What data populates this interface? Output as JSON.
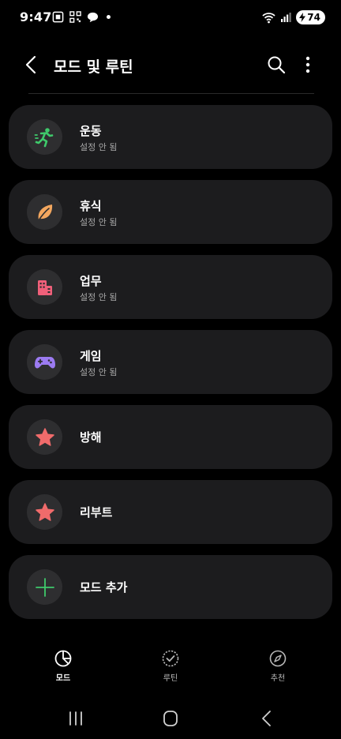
{
  "status_bar": {
    "time": "9:47",
    "battery": "74"
  },
  "header": {
    "title": "모드 및 루틴"
  },
  "modes": [
    {
      "name": "운동",
      "status": "설정 안 됨",
      "icon": "running-person-icon",
      "color": "#3fca6b"
    },
    {
      "name": "휴식",
      "status": "설정 안 됨",
      "icon": "leaf-icon",
      "color": "#f3a75f"
    },
    {
      "name": "업무",
      "status": "설정 안 됨",
      "icon": "building-icon",
      "color": "#f0607a"
    },
    {
      "name": "게임",
      "status": "설정 안 됨",
      "icon": "gamepad-icon",
      "color": "#9c7bf2"
    },
    {
      "name": "방해",
      "icon": "star-icon",
      "color": "#f06b6b"
    },
    {
      "name": "리부트",
      "icon": "star-icon",
      "color": "#f06b6b"
    },
    {
      "name": "모드 추가",
      "icon": "plus-icon",
      "color": "#3fca6b"
    }
  ],
  "bottom_nav": [
    {
      "label": "모드",
      "icon": "pie-chart-icon",
      "active": true
    },
    {
      "label": "루틴",
      "icon": "check-circle-icon",
      "active": false
    },
    {
      "label": "추천",
      "icon": "compass-icon",
      "active": false
    }
  ],
  "colors": {
    "background": "#000000",
    "card": "#1c1c1e",
    "icon_circle": "#2e2e30",
    "subtext": "#a7a7a7"
  }
}
